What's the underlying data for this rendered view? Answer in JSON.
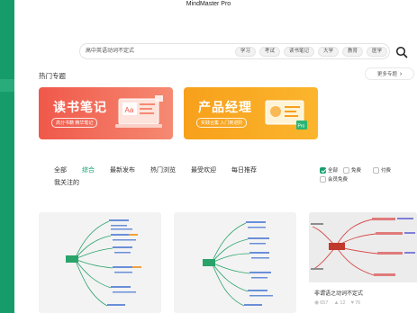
{
  "app": {
    "title": "MindMaster Pro"
  },
  "search": {
    "placeholder": "高中英语动词不定式",
    "tags": [
      "学习",
      "考试",
      "读书笔记",
      "大学",
      "教育",
      "医学"
    ]
  },
  "hot": {
    "title": "热门专题",
    "more": "更多专题",
    "banners": [
      {
        "title": "读书笔记",
        "subtitle": "高分书籍 精华笔记",
        "art_label": "Aa"
      },
      {
        "title": "产品经理",
        "subtitle": "实践合集 入门到进阶",
        "art_label": "Pro"
      }
    ]
  },
  "filters": {
    "items": [
      "全部",
      "综合",
      "最新发布",
      "热门浏览",
      "最受欢迎",
      "每日推荐"
    ],
    "active": "综合",
    "second_row": "我关注的"
  },
  "checks": [
    {
      "label": "全部",
      "checked": true
    },
    {
      "label": "免费",
      "checked": false
    },
    {
      "label": "付费",
      "checked": false
    },
    {
      "label": "会员免费",
      "checked": false
    }
  ],
  "cards": [
    {},
    {},
    {
      "title": "非谓语之动词不定式",
      "views": "657",
      "likes": "12",
      "favorites": "76"
    }
  ],
  "colors": {
    "accent": "#16a06f",
    "sidebar": "#169b6b",
    "banner_red": "#f0584a",
    "banner_orange": "#f7a01c"
  }
}
